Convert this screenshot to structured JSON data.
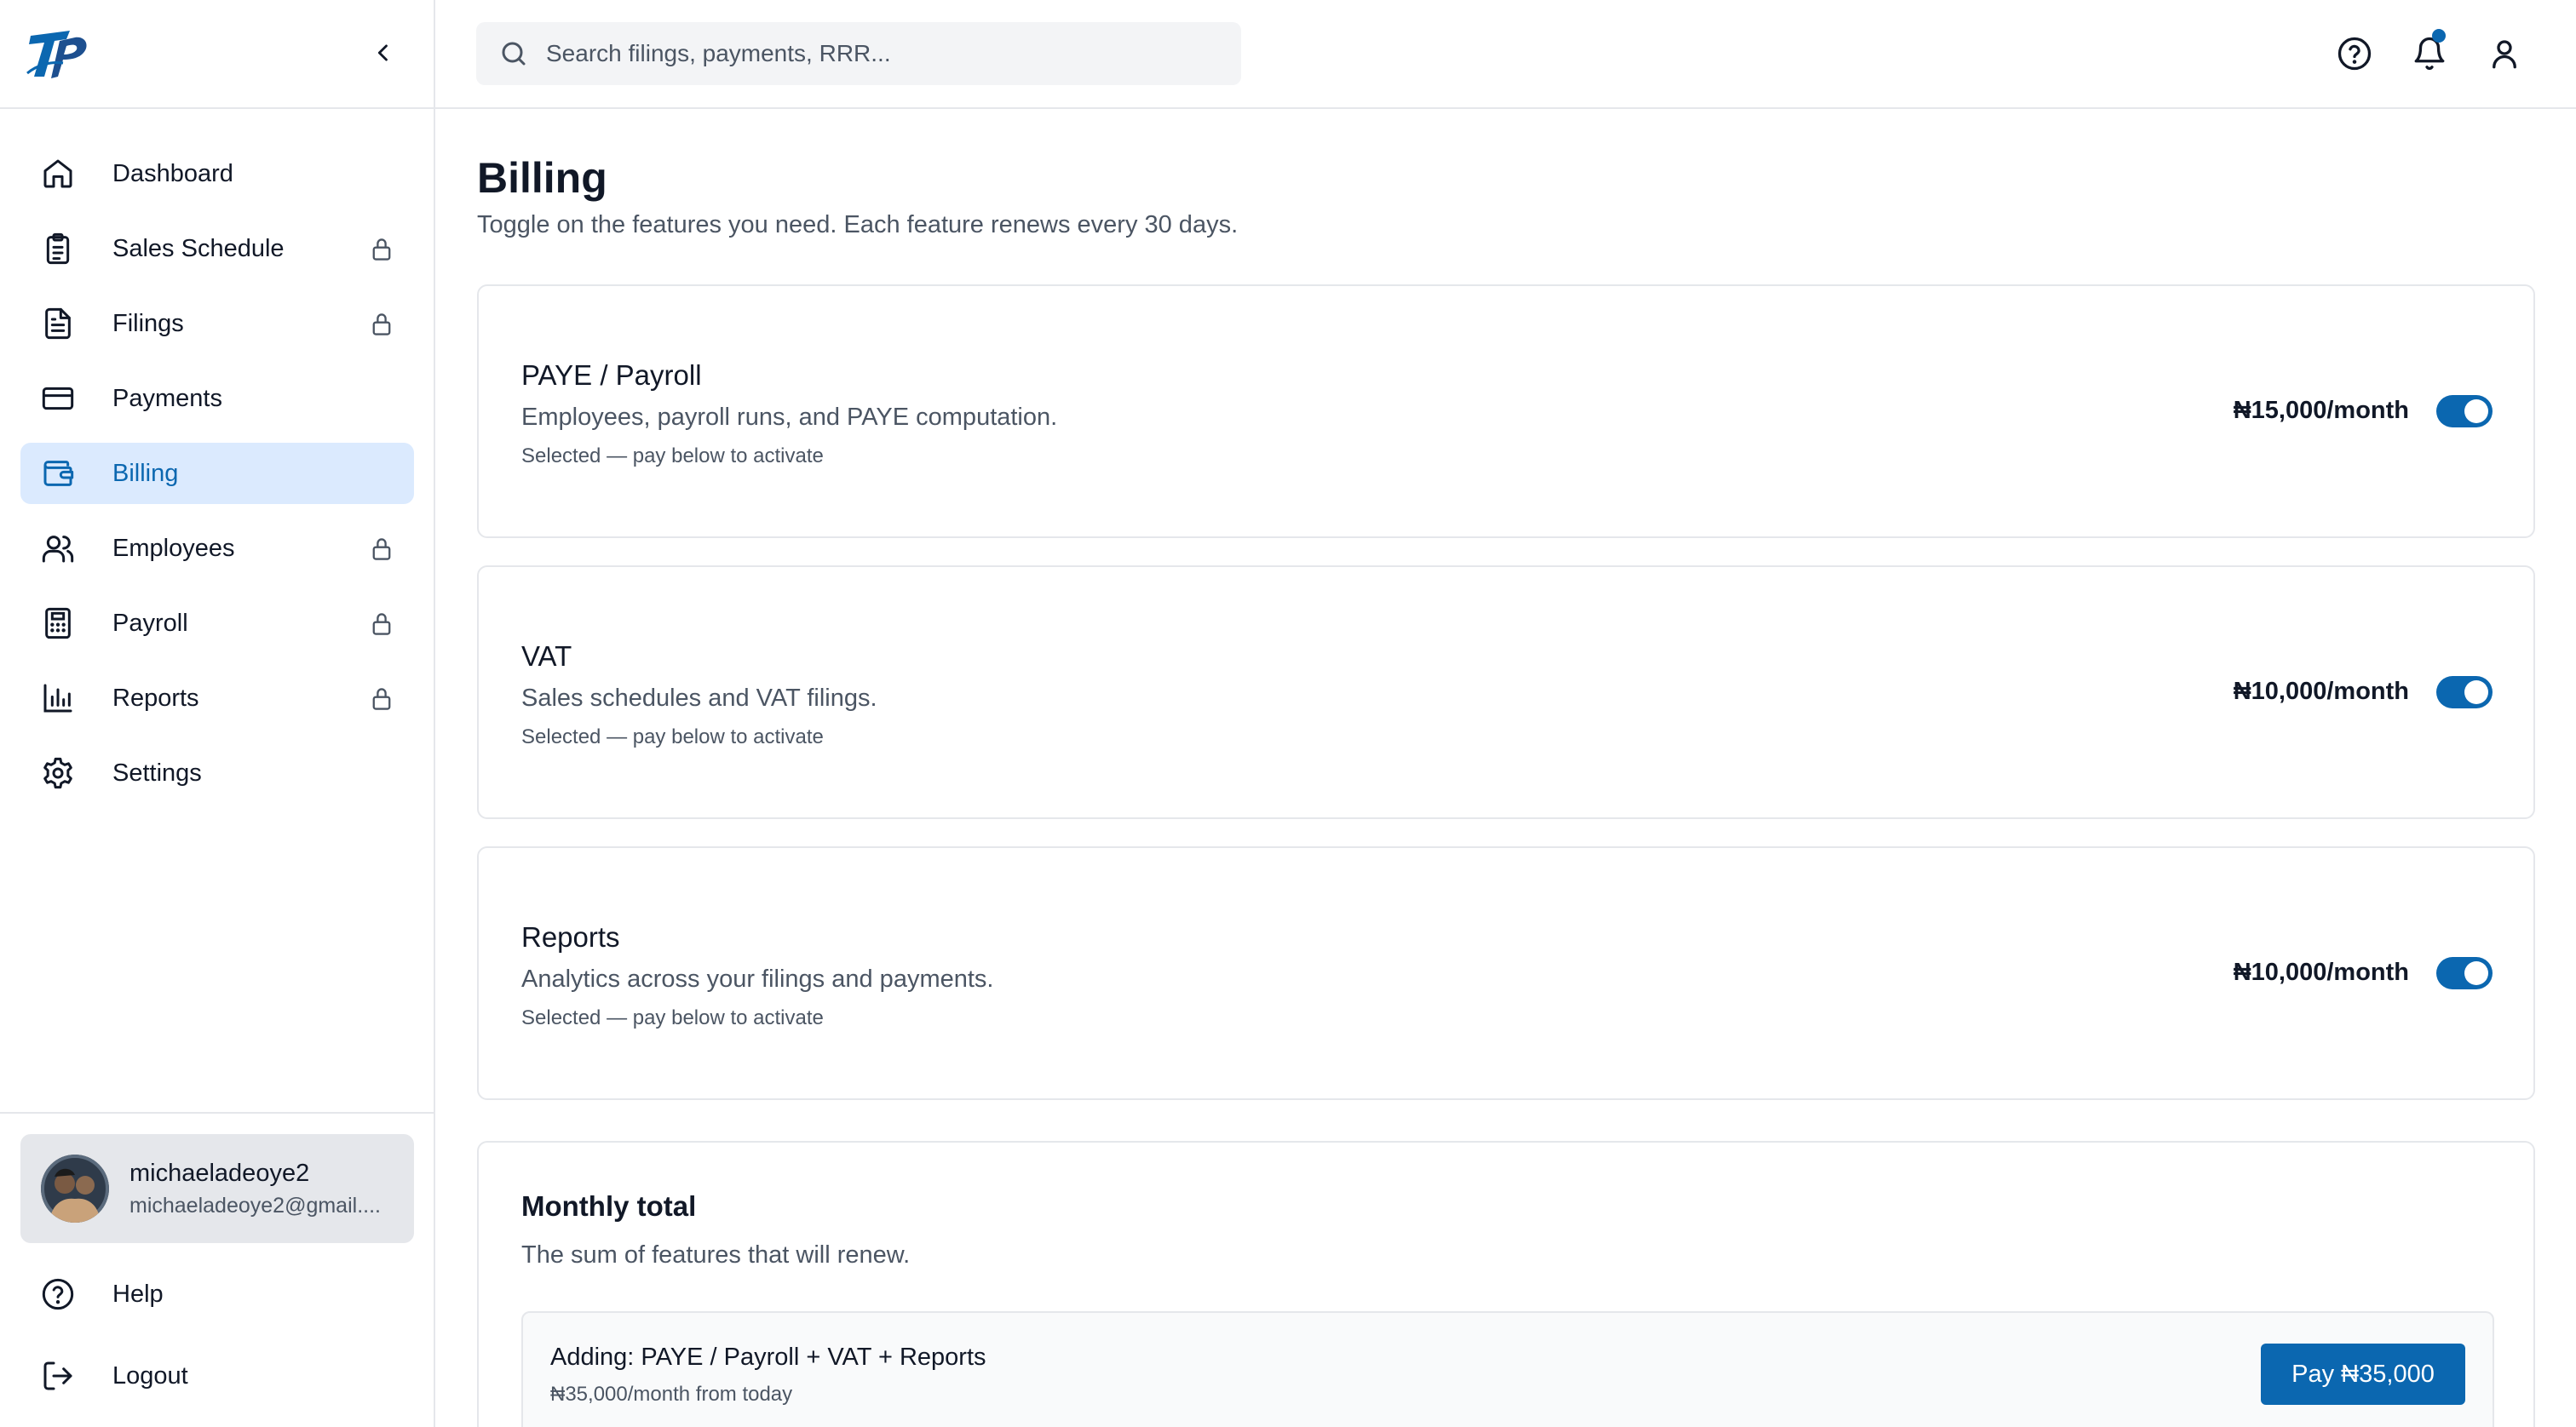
{
  "colors": {
    "accent": "#0b67b0",
    "active_bg": "#dbeafe",
    "border": "#e5e7eb",
    "muted_text": "#4b5563"
  },
  "sidebar": {
    "collapse_icon": "chevron-left-icon",
    "items": [
      {
        "label": "Dashboard",
        "icon": "home-icon",
        "locked": false,
        "active": false
      },
      {
        "label": "Sales Schedule",
        "icon": "clipboard-icon",
        "locked": true,
        "active": false
      },
      {
        "label": "Filings",
        "icon": "file-text-icon",
        "locked": true,
        "active": false
      },
      {
        "label": "Payments",
        "icon": "credit-card-icon",
        "locked": false,
        "active": false
      },
      {
        "label": "Billing",
        "icon": "wallet-icon",
        "locked": false,
        "active": true
      },
      {
        "label": "Employees",
        "icon": "users-icon",
        "locked": true,
        "active": false
      },
      {
        "label": "Payroll",
        "icon": "calculator-icon",
        "locked": true,
        "active": false
      },
      {
        "label": "Reports",
        "icon": "bar-chart-icon",
        "locked": true,
        "active": false
      },
      {
        "label": "Settings",
        "icon": "gear-icon",
        "locked": false,
        "active": false
      }
    ],
    "user": {
      "name": "michaeladeoye2",
      "email": "michaeladeoye2@gmail...."
    },
    "footer": {
      "help": "Help",
      "logout": "Logout"
    }
  },
  "topbar": {
    "search_placeholder": "Search filings, payments, RRR...",
    "search_value": ""
  },
  "main": {
    "title": "Billing",
    "subtitle": "Toggle on the features you need. Each feature renews every 30 days.",
    "features": [
      {
        "title": "PAYE / Payroll",
        "description": "Employees, payroll runs, and PAYE computation.",
        "status": "Selected — pay below to activate",
        "price": "₦15,000/month",
        "enabled": true
      },
      {
        "title": "VAT",
        "description": "Sales schedules and VAT filings.",
        "status": "Selected — pay below to activate",
        "price": "₦10,000/month",
        "enabled": true
      },
      {
        "title": "Reports",
        "description": "Analytics across your filings and payments.",
        "status": "Selected — pay below to activate",
        "price": "₦10,000/month",
        "enabled": true
      }
    ],
    "total": {
      "title": "Monthly total",
      "subtitle": "The sum of features that will renew.",
      "summary_title": "Adding: PAYE / Payroll + VAT + Reports",
      "summary_sub": "₦35,000/month from today",
      "pay_label": "Pay ₦35,000"
    }
  }
}
